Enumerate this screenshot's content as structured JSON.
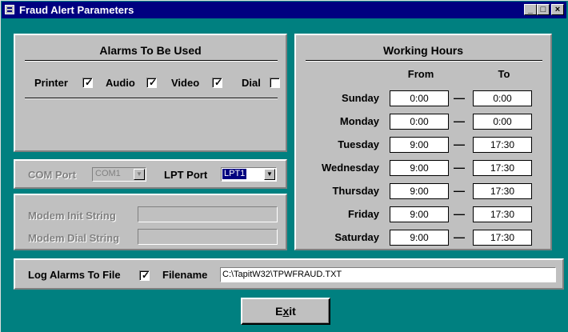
{
  "window": {
    "title": "Fraud Alert Parameters",
    "icon": "form-icon",
    "controls": {
      "minimize": "_",
      "maximize": "□",
      "close": "×"
    }
  },
  "alarms": {
    "heading": "Alarms To Be Used",
    "items": [
      {
        "label": "Printer",
        "checked": true
      },
      {
        "label": "Audio",
        "checked": true
      },
      {
        "label": "Video",
        "checked": true
      },
      {
        "label": "Dial",
        "checked": false
      }
    ]
  },
  "ports": {
    "com_label": "COM Port",
    "com_value": "COM1",
    "lpt_label": "LPT Port",
    "lpt_value": "LPT1"
  },
  "modem": {
    "init_label": "Modem Init String",
    "init_value": "",
    "dial_label": "Modem Dial String",
    "dial_value": ""
  },
  "working_hours": {
    "heading": "Working Hours",
    "from_label": "From",
    "to_label": "To",
    "separator": "—",
    "days": [
      {
        "day": "Sunday",
        "from": "0:00",
        "to": "0:00"
      },
      {
        "day": "Monday",
        "from": "0:00",
        "to": "0:00"
      },
      {
        "day": "Tuesday",
        "from": "9:00",
        "to": "17:30"
      },
      {
        "day": "Wednesday",
        "from": "9:00",
        "to": "17:30"
      },
      {
        "day": "Thursday",
        "from": "9:00",
        "to": "17:30"
      },
      {
        "day": "Friday",
        "from": "9:00",
        "to": "17:30"
      },
      {
        "day": "Saturday",
        "from": "9:00",
        "to": "17:30"
      }
    ]
  },
  "log": {
    "label": "Log Alarms To File",
    "checked": true,
    "filename_label": "Filename",
    "filename_value": "C:\\TapitW32\\TPWFRAUD.TXT"
  },
  "exit_button": {
    "label_prefix": "E",
    "label_underlined": "x",
    "label_suffix": "it"
  },
  "colors": {
    "background": "#008080",
    "titlebar": "#000080",
    "panel": "#c0c0c0",
    "disabled_text": "#808080"
  }
}
